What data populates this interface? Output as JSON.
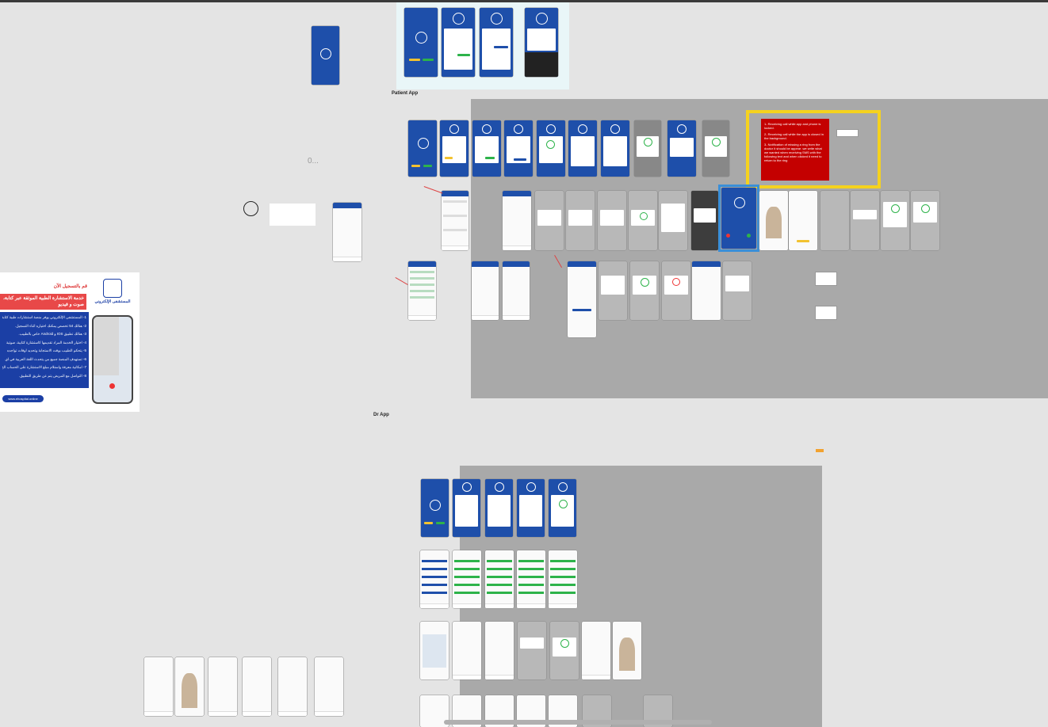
{
  "canvas": {
    "labels": {
      "patient_app": "Patient App",
      "dr_app": "Dr App",
      "placeholder_zero": "0..."
    }
  },
  "red_note": {
    "line1": "1- Receiving call while app and phone is locked.",
    "line2": "2- Receiving call while the app is closed in the background.",
    "line3": "3- Notification of missing a ring from the doctor it should be appear .we write what we wanted when receiving SMS with the following text and when clicked it need to return to the ring"
  },
  "ad": {
    "register_now": "قم بالتسجيل الآن",
    "headline": "خدمة الاستشارة الطبية الموثقة عبر كتابة، صوت و فيديو",
    "brand": "المستشفى الإلكتروني",
    "url": "www.ehospital.online",
    "points": [
      "1- المستشفى الإلكتروني يوفر منصة استشارات طبية كتابة",
      "2- هنالك 54 تخصص يمكنك اختياره أثناء التسجيل.",
      "3- هنالك تطبيق IOS و Android خاص بالطبيب.",
      "4- اختيار الخدمة المراد تقديمها كاستشارة كتابية، صوتية",
      "5- يتحكم الطبيب بوقت الاستجابة وتحديد أوقات تواجده",
      "6- تستهدف المنصة جميع من يتحدث اللغة العربية في أي",
      "7- امكانية معرفة واستلام مبلغ الاستشارة على الحساب الخ",
      "8- التواصل مع المريض يتم عن طريق التطبيق."
    ]
  },
  "colors": {
    "canvas": "#e4e4e4",
    "section": "#a9a9a9",
    "brand_blue": "#1e4faa",
    "accent_green": "#2db34a",
    "accent_yellow": "#f2c230",
    "highlight_yellow": "#f5d21e",
    "alert_red": "#c40000",
    "ad_red": "#e84848"
  }
}
